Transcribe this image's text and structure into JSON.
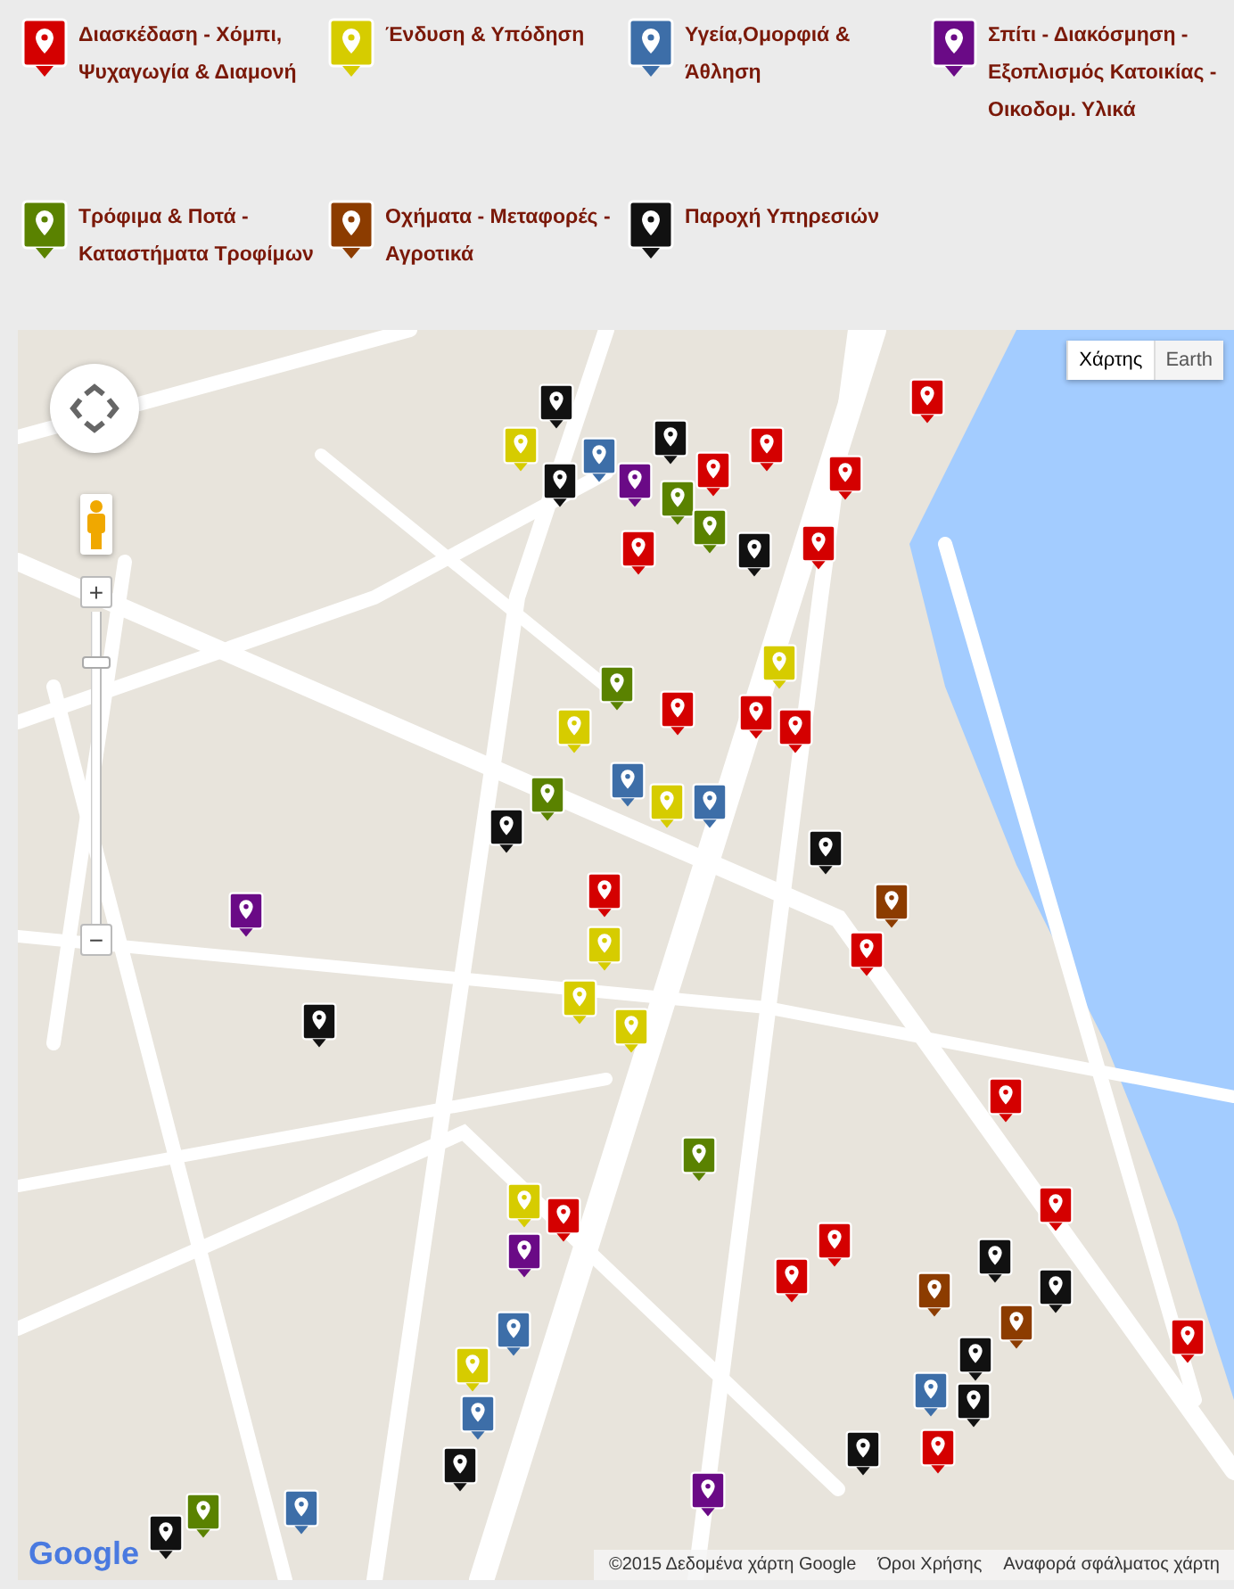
{
  "legend": [
    {
      "label": "Διασκέδαση - Χόμπι, Ψυχαγωγία & Διαμονή",
      "color": "#d40000"
    },
    {
      "label": "Ένδυση & Υπόδηση",
      "color": "#d6cc00"
    },
    {
      "label": "Υγεία,Ομορφιά & Άθληση",
      "color": "#3d6ea8"
    },
    {
      "label": "Σπίτι - Διακόσμηση - Εξοπλισμός Κατοικίας - Οικοδομ. Υλικά",
      "color": "#6a0a86"
    },
    {
      "label": "Τρόφιμα & Ποτά - Καταστήματα Τροφίμων",
      "color": "#5a8200"
    },
    {
      "label": "Οχήματα - Μεταφορές - Αγροτικά",
      "color": "#8c3c00"
    },
    {
      "label": "Παροχή Υπηρεσιών",
      "color": "#111111"
    }
  ],
  "map": {
    "map_types": [
      {
        "label": "Χάρτης",
        "selected": true
      },
      {
        "label": "Earth",
        "selected": false
      }
    ],
    "zoom_in": "+",
    "zoom_out": "−",
    "zoom_slider": {
      "level": 0.85
    },
    "markers": [
      {
        "color": "#d40000"
      },
      {
        "color": "#111111"
      },
      {
        "color": "#d6cc00"
      },
      {
        "color": "#3d6ea8"
      },
      {
        "color": "#111111"
      },
      {
        "color": "#d40000"
      },
      {
        "color": "#d40000"
      },
      {
        "color": "#111111"
      },
      {
        "color": "#6a0a86"
      },
      {
        "color": "#5a8200"
      },
      {
        "color": "#d40000"
      },
      {
        "color": "#5a8200"
      },
      {
        "color": "#d40000"
      },
      {
        "color": "#111111"
      },
      {
        "color": "#d40000"
      },
      {
        "color": "#d6cc00"
      },
      {
        "color": "#5a8200"
      },
      {
        "color": "#d6cc00"
      },
      {
        "color": "#d40000"
      },
      {
        "color": "#d40000"
      },
      {
        "color": "#d40000"
      },
      {
        "color": "#3d6ea8"
      },
      {
        "color": "#3d6ea8"
      },
      {
        "color": "#d6cc00"
      },
      {
        "color": "#5a8200"
      },
      {
        "color": "#111111"
      },
      {
        "color": "#111111"
      },
      {
        "color": "#8c3c00"
      },
      {
        "color": "#d40000"
      },
      {
        "color": "#d40000"
      },
      {
        "color": "#d6cc00"
      },
      {
        "color": "#d6cc00"
      },
      {
        "color": "#d6cc00"
      },
      {
        "color": "#6a0a86"
      },
      {
        "color": "#111111"
      },
      {
        "color": "#d40000"
      },
      {
        "color": "#5a8200"
      },
      {
        "color": "#d6cc00"
      },
      {
        "color": "#d40000"
      },
      {
        "color": "#d40000"
      },
      {
        "color": "#d40000"
      },
      {
        "color": "#d40000"
      },
      {
        "color": "#111111"
      },
      {
        "color": "#6a0a86"
      },
      {
        "color": "#8c3c00"
      },
      {
        "color": "#111111"
      },
      {
        "color": "#8c3c00"
      },
      {
        "color": "#3d6ea8"
      },
      {
        "color": "#111111"
      },
      {
        "color": "#d40000"
      },
      {
        "color": "#d6cc00"
      },
      {
        "color": "#3d6ea8"
      },
      {
        "color": "#111111"
      },
      {
        "color": "#d40000"
      },
      {
        "color": "#3d6ea8"
      },
      {
        "color": "#111111"
      },
      {
        "color": "#111111"
      },
      {
        "color": "#6a0a86"
      },
      {
        "color": "#3d6ea8"
      },
      {
        "color": "#5a8200"
      },
      {
        "color": "#111111"
      }
    ],
    "logo": "Google",
    "attribution": "©2015 Δεδομένα χάρτη Google",
    "terms_link": "Όροι Χρήσης",
    "report_link": "Αναφορά σφάλματος χάρτη"
  }
}
